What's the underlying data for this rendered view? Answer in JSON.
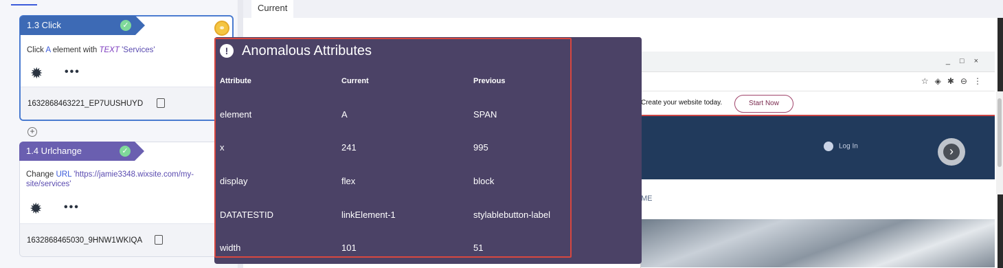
{
  "steps": [
    {
      "title": "1.3 Click",
      "desc_prefix": "Click",
      "desc_keyword": "A",
      "desc_mid": " element with ",
      "desc_tag": "TEXT",
      "desc_value": "'Services'",
      "id": "1632868463221_EP7UUSHUYD"
    },
    {
      "title": "1.4 Urlchange",
      "desc_prefix": "Change",
      "desc_keyword": "URL",
      "desc_value": "'https://jamie3348.wixsite.com/my-site/services'",
      "id": "1632868465030_9HNW1WKIQA"
    }
  ],
  "icons": {
    "check": "check-circle-icon",
    "anomaly": "link-warning-icon",
    "gear": "gear-icon",
    "more": "more-dots-icon",
    "expand": "chevron-down-icon",
    "copy": "copy-icon",
    "add": "plus-circle-icon",
    "alert": "exclamation-circle-icon"
  },
  "tabs": {
    "current": "Current"
  },
  "popup": {
    "title": "Anomalous Attributes",
    "headers": [
      "Attribute",
      "Current",
      "Previous"
    ],
    "rows": [
      [
        "element",
        "A",
        "SPAN"
      ],
      [
        "x",
        "241",
        "995"
      ],
      [
        "display",
        "flex",
        "block"
      ],
      [
        "DATATESTID",
        "linkElement-1",
        "stylablebutton-label"
      ],
      [
        "width",
        "101",
        "51"
      ]
    ]
  },
  "browser": {
    "promo_text": "Create your website today.",
    "start_now": "Start Now",
    "login": "Log In",
    "nav_text": "ME"
  },
  "colors": {
    "popup_bg": "#4b4266",
    "highlight_border": "#d9473f",
    "step_blue": "#3d6ab5",
    "step_purple": "#6a5fb0"
  }
}
